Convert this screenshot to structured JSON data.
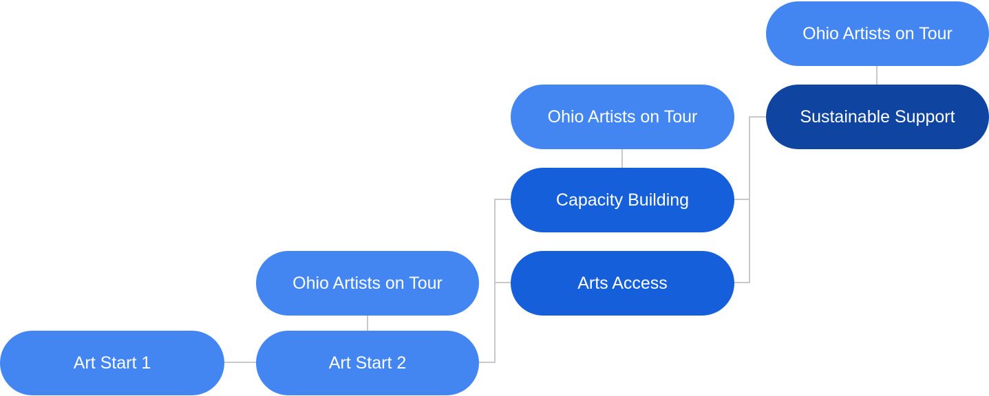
{
  "colors": {
    "light_node": "#4386f2",
    "mid_node": "#155fda",
    "dark_node": "#0f45a0",
    "connector": "#c8c8c8",
    "text": "#ffffff"
  },
  "nodes": {
    "art_start_1": "Art Start 1",
    "art_start_2": "Art Start 2",
    "ohio_tour_1": "Ohio Artists on Tour",
    "arts_access": "Arts Access",
    "capacity_building": "Capacity Building",
    "ohio_tour_2": "Ohio Artists on Tour",
    "sustainable_support": "Sustainable Support",
    "ohio_tour_3": "Ohio Artists on Tour"
  }
}
